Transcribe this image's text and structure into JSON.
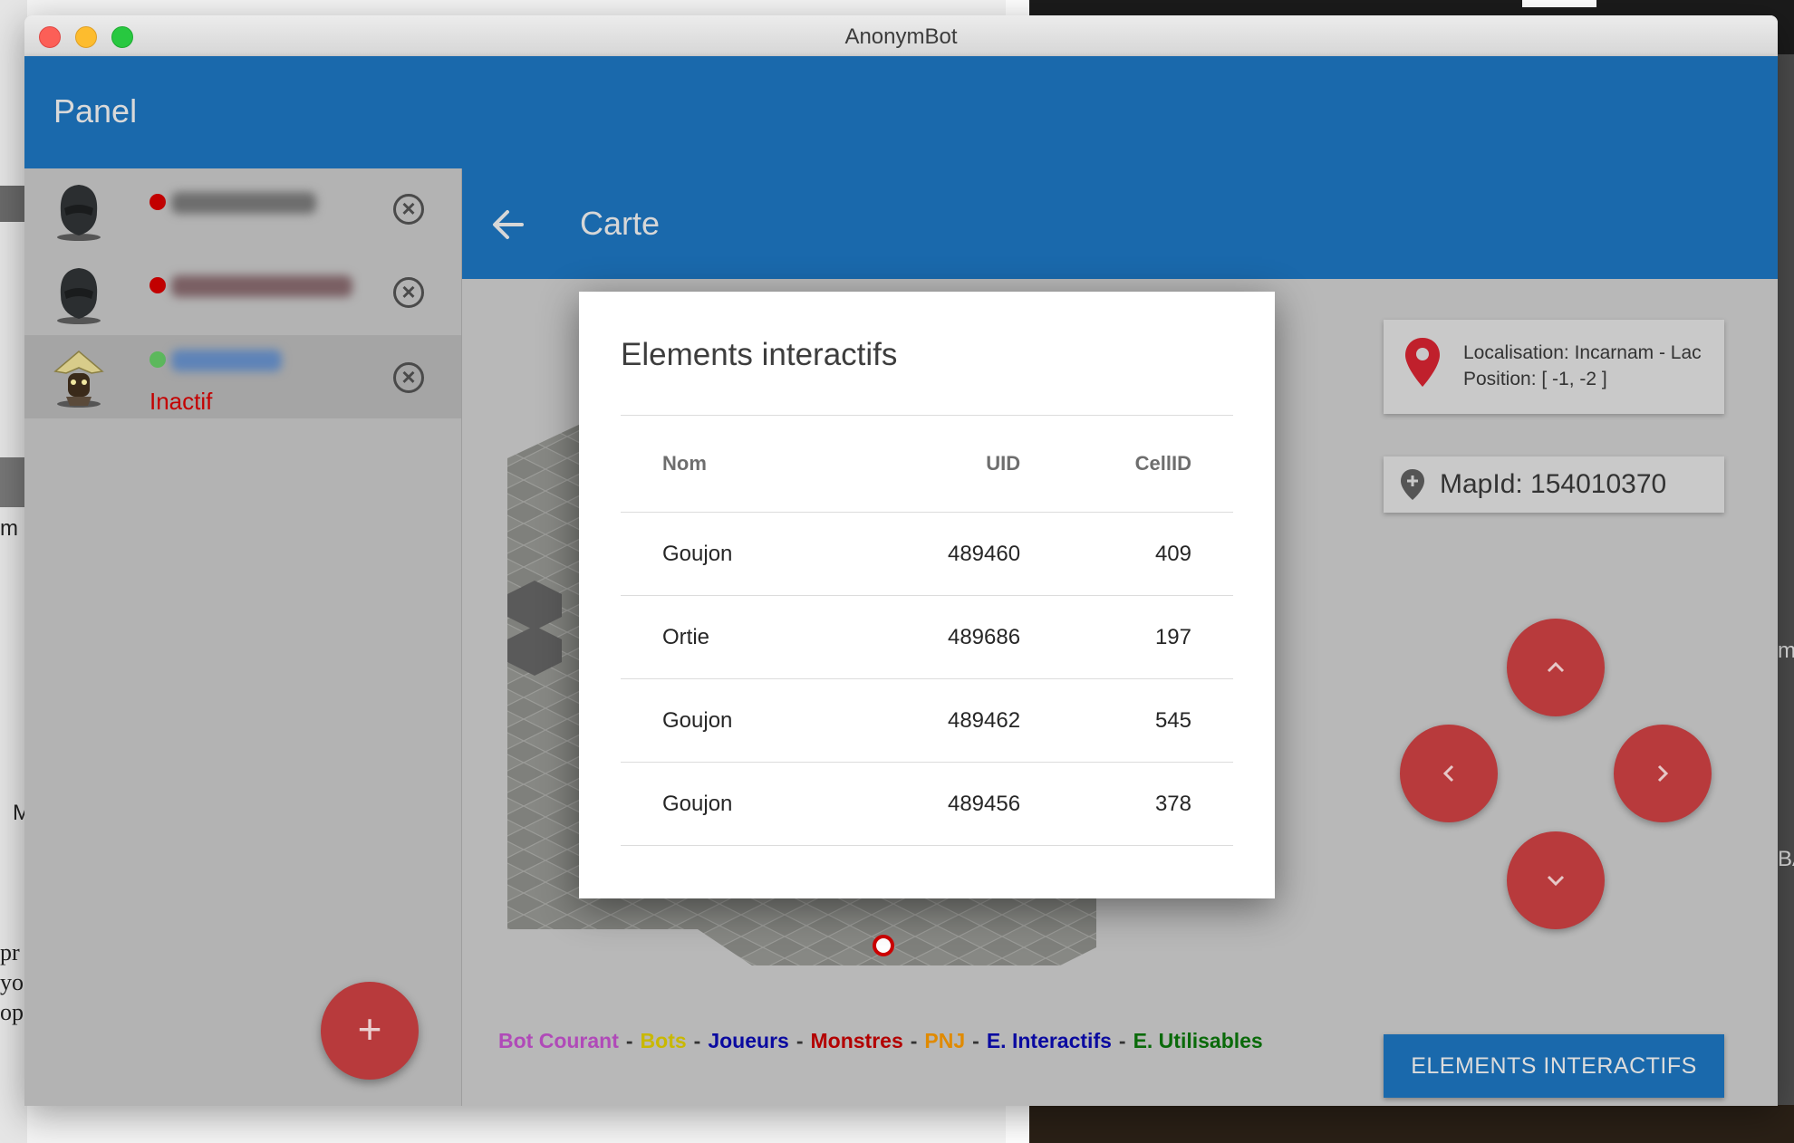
{
  "window": {
    "title": "AnonymBot"
  },
  "app": {
    "title": "Panel"
  },
  "sidebar": {
    "bots": [
      {
        "status_color": "#c20000",
        "name_blurred": true,
        "status_text": ""
      },
      {
        "status_color": "#c20000",
        "name_blurred": true,
        "status_text": ""
      },
      {
        "status_color": "#5cb85c",
        "name_blurred": true,
        "status_text": "Inactif",
        "active": true
      }
    ],
    "add_button_label": "+"
  },
  "main": {
    "title": "Carte",
    "location": {
      "line1": "Localisation: Incarnam - Lac",
      "line2": "Position: [ -1, -2 ]"
    },
    "map_id": "MapId: 154010370",
    "legend": [
      {
        "label": "Bot Courant",
        "color": "#b04ab8"
      },
      {
        "label": "Bots",
        "color": "#c9b800"
      },
      {
        "label": "Joueurs",
        "color": "#0a0aa0"
      },
      {
        "label": "Monstres",
        "color": "#b30000"
      },
      {
        "label": "PNJ",
        "color": "#e08a00"
      },
      {
        "label": "E. Interactifs",
        "color": "#0a0aa0"
      },
      {
        "label": "E. Utilisables",
        "color": "#0a6a0a"
      }
    ],
    "legend_separator": "-",
    "elements_button": "ELEMENTS INTERACTIFS"
  },
  "dialog": {
    "title": "Elements interactifs",
    "columns": {
      "nom": "Nom",
      "uid": "UID",
      "cellid": "CellID"
    },
    "rows": [
      {
        "nom": "Goujon",
        "uid": "489460",
        "cellid": "409"
      },
      {
        "nom": "Ortie",
        "uid": "489686",
        "cellid": "197"
      },
      {
        "nom": "Goujon",
        "uid": "489462",
        "cellid": "545"
      },
      {
        "nom": "Goujon",
        "uid": "489456",
        "cellid": "378"
      }
    ]
  },
  "background": {
    "left_text_lines": [
      "pr",
      "yo",
      "op"
    ],
    "left_word": "m",
    "left_word2": "M",
    "right_word": "ma",
    "right_word2": "BA"
  },
  "colors": {
    "primary": "#1a69ac",
    "accent_red": "#b83a3c",
    "overlay_gray": "#b8b8b8"
  }
}
